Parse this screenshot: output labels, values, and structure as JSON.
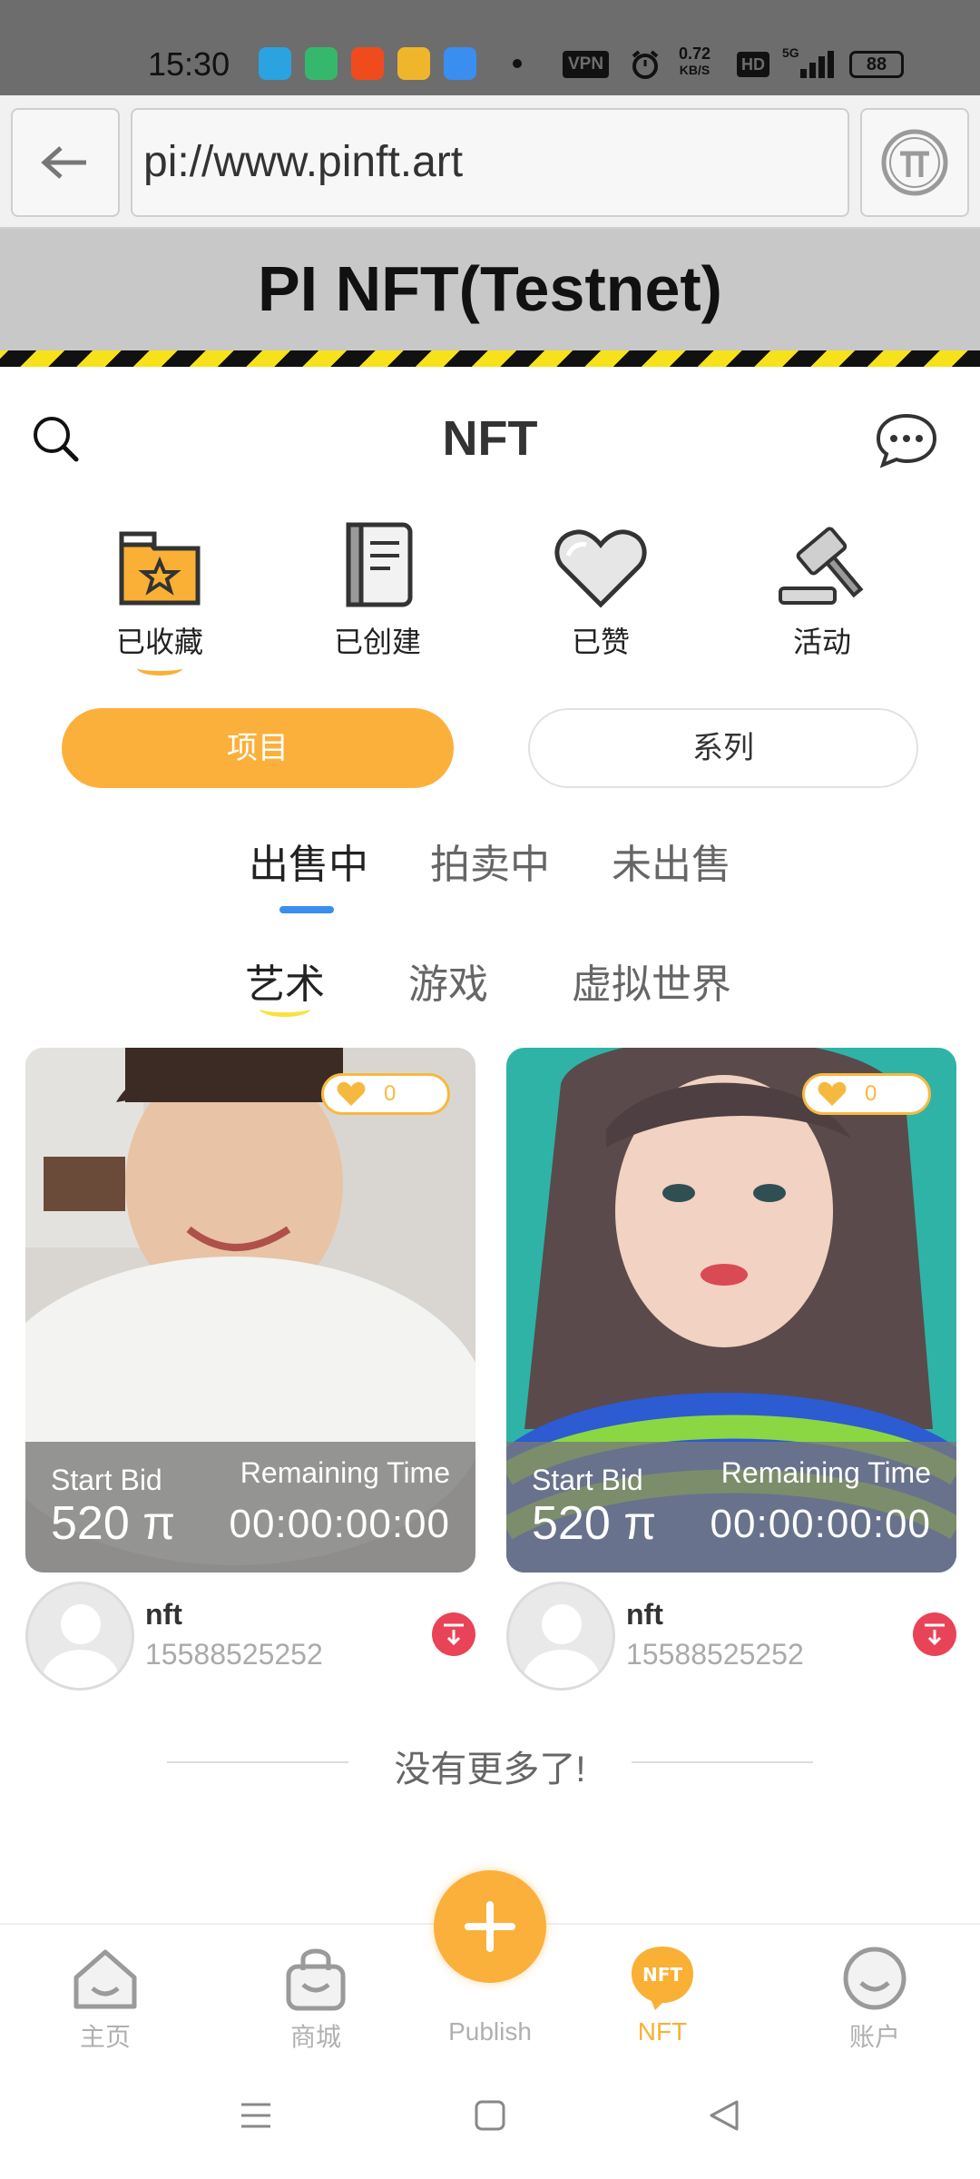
{
  "status_bar": {
    "time": "15:30",
    "vpn": "VPN",
    "net_speed_value": "0.72",
    "net_speed_unit": "KB/S",
    "hd": "HD",
    "network": "5G",
    "battery": "88",
    "app_icon_colors": [
      "#2aa3e0",
      "#35b86b",
      "#f04b1d",
      "#f0b62b",
      "#3a8ef0"
    ]
  },
  "browser": {
    "url": "pi://www.pinft.art",
    "back_icon": "arrow-left-icon",
    "pi_icon": "pi-logo-icon"
  },
  "banner": {
    "title": "PI NFT(Testnet)"
  },
  "header": {
    "title": "NFT",
    "search_icon": "search-icon",
    "message_icon": "message-icon"
  },
  "categories": [
    {
      "label": "已收藏",
      "icon": "folder-star-icon",
      "active": true
    },
    {
      "label": "已创建",
      "icon": "notebook-icon",
      "active": false
    },
    {
      "label": "已赞",
      "icon": "heart-icon",
      "active": false
    },
    {
      "label": "活动",
      "icon": "gavel-icon",
      "active": false
    }
  ],
  "segment": {
    "left": "项目",
    "right": "系列",
    "active": "left"
  },
  "status_tabs": [
    {
      "label": "出售中",
      "active": true
    },
    {
      "label": "拍卖中",
      "active": false
    },
    {
      "label": "未出售",
      "active": false
    }
  ],
  "type_tabs": [
    {
      "label": "艺术",
      "active": true
    },
    {
      "label": "游戏",
      "active": false
    },
    {
      "label": "虚拟世界",
      "active": false
    }
  ],
  "cards": [
    {
      "likes": "0",
      "start_bid_label": "Start Bid",
      "start_bid_value": "520 π",
      "remaining_label": "Remaining Time",
      "remaining_value": "00:00:00:00",
      "owner_name": "nft",
      "owner_phone": "15588525252"
    },
    {
      "likes": "0",
      "start_bid_label": "Start Bid",
      "start_bid_value": "520 π",
      "remaining_label": "Remaining Time",
      "remaining_value": "00:00:00:00",
      "owner_name": "nft",
      "owner_phone": "15588525252"
    }
  ],
  "no_more": "没有更多了!",
  "bottom_nav": [
    {
      "label": "主页",
      "icon": "home-icon",
      "active": false
    },
    {
      "label": "商城",
      "icon": "shopping-bag-icon",
      "active": false
    },
    {
      "label": "Publish",
      "icon": "plus-icon",
      "active": false
    },
    {
      "label": "NFT",
      "icon": "nft-badge-icon",
      "active": true
    },
    {
      "label": "账户",
      "icon": "account-icon",
      "active": false
    }
  ],
  "colors": {
    "accent": "#fbb03b",
    "tab_indicator": "#3a8ef0",
    "download": "#e94358"
  }
}
